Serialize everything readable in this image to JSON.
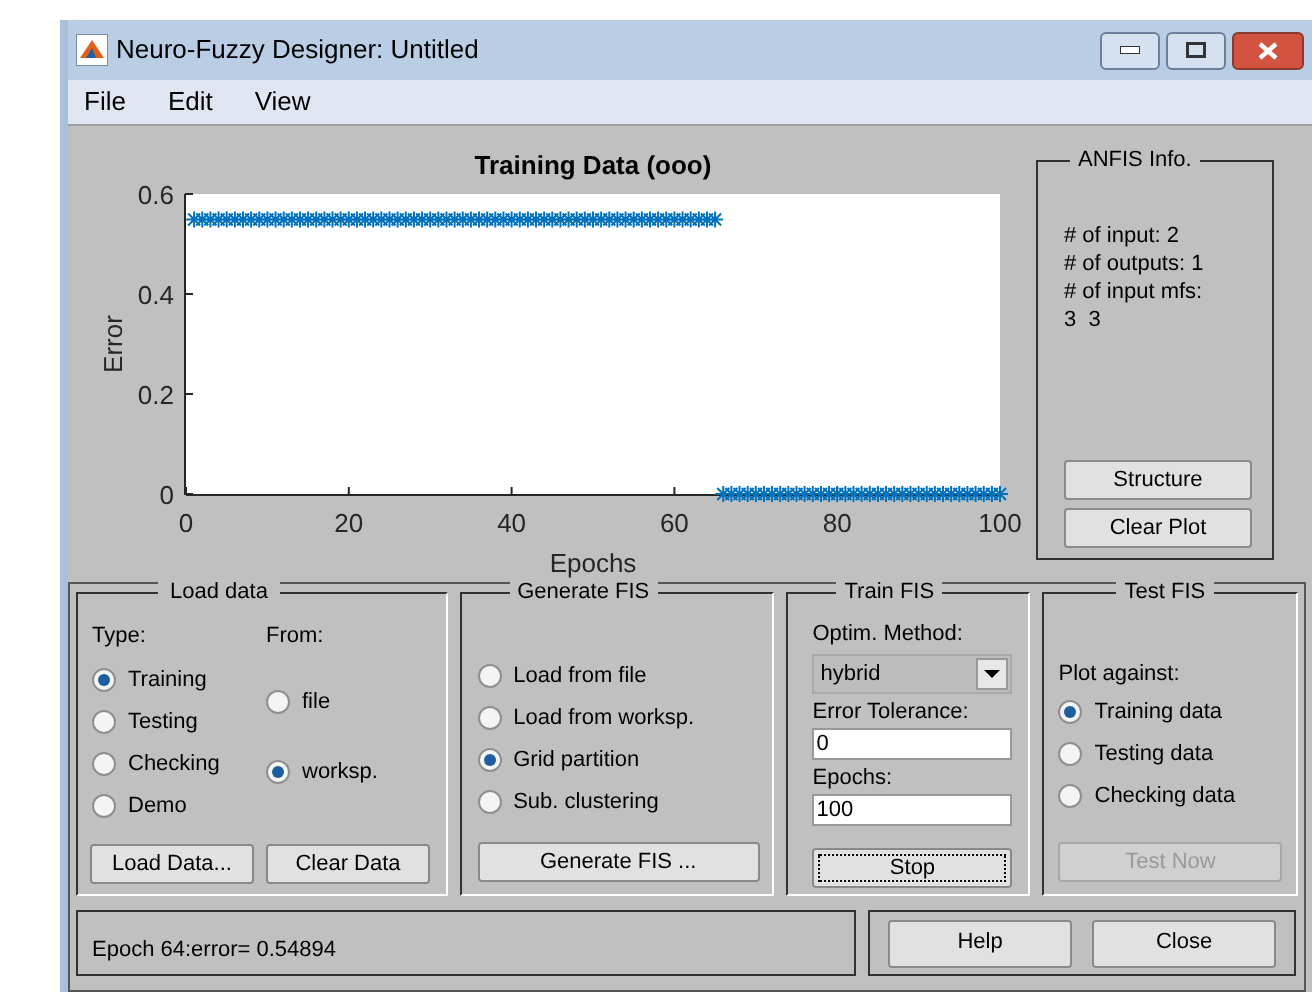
{
  "window": {
    "title": "Neuro-Fuzzy Designer: Untitled"
  },
  "menu": [
    "File",
    "Edit",
    "View"
  ],
  "plot": {
    "chart_data": {
      "type": "scatter",
      "title": "Training Data (ooo)",
      "xlabel": "Epochs",
      "ylabel": "Error",
      "xlim": [
        0,
        100
      ],
      "ylim": [
        0,
        0.6
      ],
      "xticks": [
        0,
        20,
        40,
        60,
        80,
        100
      ],
      "yticks": [
        0,
        0.2,
        0.4,
        0.6
      ],
      "x": [
        1,
        2,
        3,
        4,
        5,
        6,
        7,
        8,
        9,
        10,
        11,
        12,
        13,
        14,
        15,
        16,
        17,
        18,
        19,
        20,
        21,
        22,
        23,
        24,
        25,
        26,
        27,
        28,
        29,
        30,
        31,
        32,
        33,
        34,
        35,
        36,
        37,
        38,
        39,
        40,
        41,
        42,
        43,
        44,
        45,
        46,
        47,
        48,
        49,
        50,
        51,
        52,
        53,
        54,
        55,
        56,
        57,
        58,
        59,
        60,
        61,
        62,
        63,
        64,
        65,
        66,
        67,
        68,
        69,
        70,
        71,
        72,
        73,
        74,
        75,
        76,
        77,
        78,
        79,
        80,
        81,
        82,
        83,
        84,
        85,
        86,
        87,
        88,
        89,
        90,
        91,
        92,
        93,
        94,
        95,
        96,
        97,
        98,
        99,
        100
      ],
      "series": [
        {
          "color": "#0072bd",
          "values": [
            0.549,
            0.549,
            0.549,
            0.549,
            0.549,
            0.549,
            0.549,
            0.549,
            0.549,
            0.549,
            0.549,
            0.549,
            0.549,
            0.549,
            0.549,
            0.549,
            0.549,
            0.549,
            0.549,
            0.549,
            0.549,
            0.549,
            0.549,
            0.549,
            0.549,
            0.549,
            0.549,
            0.549,
            0.549,
            0.549,
            0.549,
            0.549,
            0.549,
            0.549,
            0.549,
            0.549,
            0.549,
            0.549,
            0.549,
            0.549,
            0.549,
            0.549,
            0.549,
            0.549,
            0.549,
            0.549,
            0.549,
            0.549,
            0.549,
            0.549,
            0.549,
            0.549,
            0.549,
            0.549,
            0.549,
            0.549,
            0.549,
            0.549,
            0.549,
            0.549,
            0.549,
            0.549,
            0.549,
            0.549,
            0.549,
            0,
            0,
            0,
            0,
            0,
            0,
            0,
            0,
            0,
            0,
            0,
            0,
            0,
            0,
            0,
            0,
            0,
            0,
            0,
            0,
            0,
            0,
            0,
            0,
            0,
            0,
            0,
            0,
            0,
            0,
            0,
            0,
            0,
            0,
            0
          ]
        }
      ]
    }
  },
  "anfis_info": {
    "title": "ANFIS Info.",
    "lines": [
      "# of input: 2",
      "# of outputs: 1",
      "# of input mfs:",
      "3  3"
    ],
    "buttons": [
      "Structure",
      "Clear Plot"
    ]
  },
  "load_data": {
    "title": "Load data",
    "type_label": "Type:",
    "from_label": "From:",
    "type_options": [
      {
        "label": "Training",
        "selected": true
      },
      {
        "label": "Testing",
        "selected": false
      },
      {
        "label": "Checking",
        "selected": false
      },
      {
        "label": "Demo",
        "selected": false
      }
    ],
    "from_options": [
      {
        "label": "file",
        "selected": false
      },
      {
        "label": "worksp.",
        "selected": true
      }
    ],
    "buttons": [
      "Load Data...",
      "Clear Data"
    ]
  },
  "generate_fis": {
    "title": "Generate FIS",
    "options": [
      {
        "label": "Load from file",
        "selected": false
      },
      {
        "label": "Load from worksp.",
        "selected": false
      },
      {
        "label": "Grid partition",
        "selected": true
      },
      {
        "label": "Sub. clustering",
        "selected": false
      }
    ],
    "button": "Generate FIS ..."
  },
  "train_fis": {
    "title": "Train FIS",
    "method_label": "Optim. Method:",
    "method": "hybrid",
    "tolerance_label": "Error Tolerance:",
    "tolerance": "0",
    "epochs_label": "Epochs:",
    "epochs": "100",
    "button": {
      "label": "Stop",
      "focused": true
    }
  },
  "test_fis": {
    "title": "Test FIS",
    "plot_against_label": "Plot against:",
    "options": [
      {
        "label": "Training data",
        "selected": true
      },
      {
        "label": "Testing data",
        "selected": false
      },
      {
        "label": "Checking data",
        "selected": false
      }
    ],
    "button": {
      "label": "Test Now",
      "disabled": true
    }
  },
  "status": "Epoch 64:error= 0.54894",
  "buttons": [
    "Help",
    "Close"
  ]
}
